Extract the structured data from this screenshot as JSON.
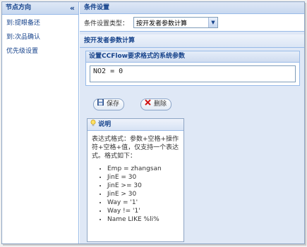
{
  "left_panel": {
    "title": "节点方向",
    "collapse_glyph": "«",
    "items": [
      {
        "label": "到:提眼备还"
      },
      {
        "label": "到:次品确认"
      },
      {
        "label": "优先级设置"
      }
    ]
  },
  "main": {
    "title": "条件设置",
    "condition_type_label": "条件设置类型：",
    "condition_type_value": "按开发者参数计算",
    "section_title": "按开发者参数计算",
    "format_box_title": "设置CCFlow要求格式的系统参数",
    "expression_value": "NO2 = 0"
  },
  "toolbar": {
    "save_label": "保存",
    "delete_label": "删除"
  },
  "help": {
    "title": "说明",
    "description": "表达式格式：参数+空格+操作符+空格+值，仅支持一个表达式。格式如下：",
    "examples": [
      "Emp = zhangsan",
      "JinE = 30",
      "JinE >= 30",
      "JinE > 30",
      "Way = '1'",
      "Way != '1'",
      "Name LIKE %li%"
    ]
  },
  "icons": {
    "save": "save-icon",
    "delete": "delete-icon",
    "help": "lightbulb-icon",
    "dropdown": "chevron-down-icon"
  }
}
